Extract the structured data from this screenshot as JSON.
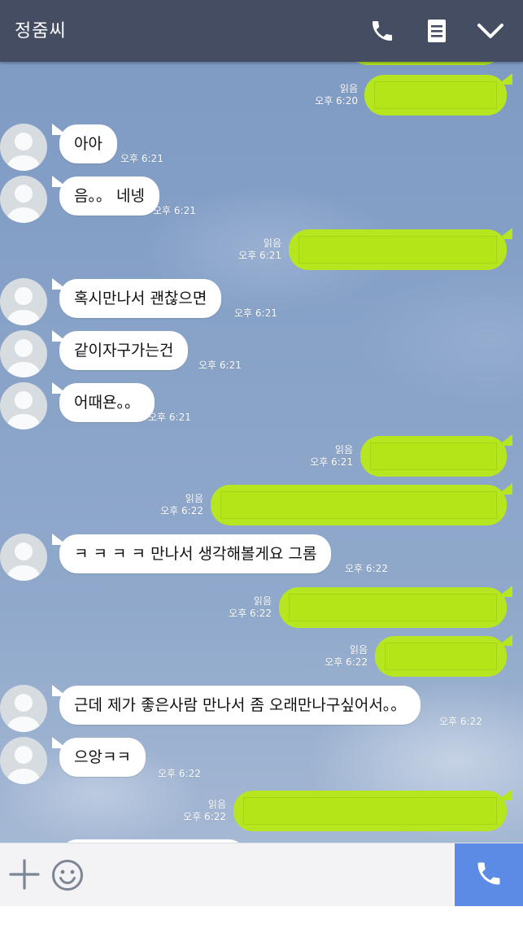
{
  "header": {
    "title": "정줌씨",
    "icons": [
      "phone-icon",
      "notes-icon",
      "chevron-down-icon"
    ]
  },
  "messages": [
    {
      "dir": "out",
      "read": "읽음",
      "time": "오후 6:20"
    },
    {
      "dir": "in",
      "text": "아아",
      "time": "오후 6:21"
    },
    {
      "dir": "in",
      "text": "음。。 네넹",
      "time": "오후 6:21"
    },
    {
      "dir": "out",
      "read": "읽음",
      "time": "오후 6:21"
    },
    {
      "dir": "in",
      "text": "혹시만나서 괜찮으면",
      "time": "오후 6:21"
    },
    {
      "dir": "in",
      "text": "같이자구가는건",
      "time": "오후 6:21"
    },
    {
      "dir": "in",
      "text": "어때욘。。",
      "time": "오후 6:21"
    },
    {
      "dir": "out",
      "read": "읽음",
      "time": "오후 6:21"
    },
    {
      "dir": "out",
      "read": "읽음",
      "time": "오후 6:22"
    },
    {
      "dir": "in",
      "text": "ㅋ ㅋ ㅋ ㅋ 만나서 생각해볼게요 그롬",
      "time": "오후 6:22"
    },
    {
      "dir": "out",
      "read": "읽음",
      "time": "오후 6:22"
    },
    {
      "dir": "out",
      "read": "읽음",
      "time": "오후 6:22"
    },
    {
      "dir": "in",
      "text": "근데 제가 좋은사람 만나서 좀 오래만나구싶어서。。",
      "time": "오후 6:22"
    },
    {
      "dir": "in",
      "text": "으앙ㅋㅋ",
      "time": "오후 6:22"
    },
    {
      "dir": "out",
      "read": "읽음",
      "time": "오후 6:22"
    }
  ],
  "input": {
    "placeholder": "",
    "icons": [
      "plus-icon",
      "emoji-icon",
      "phone-icon"
    ]
  },
  "colors": {
    "header": "#454d63",
    "outgoing_bubble": "#b5e61f",
    "incoming_bubble": "#ffffff",
    "call_button": "#5b8be4"
  }
}
